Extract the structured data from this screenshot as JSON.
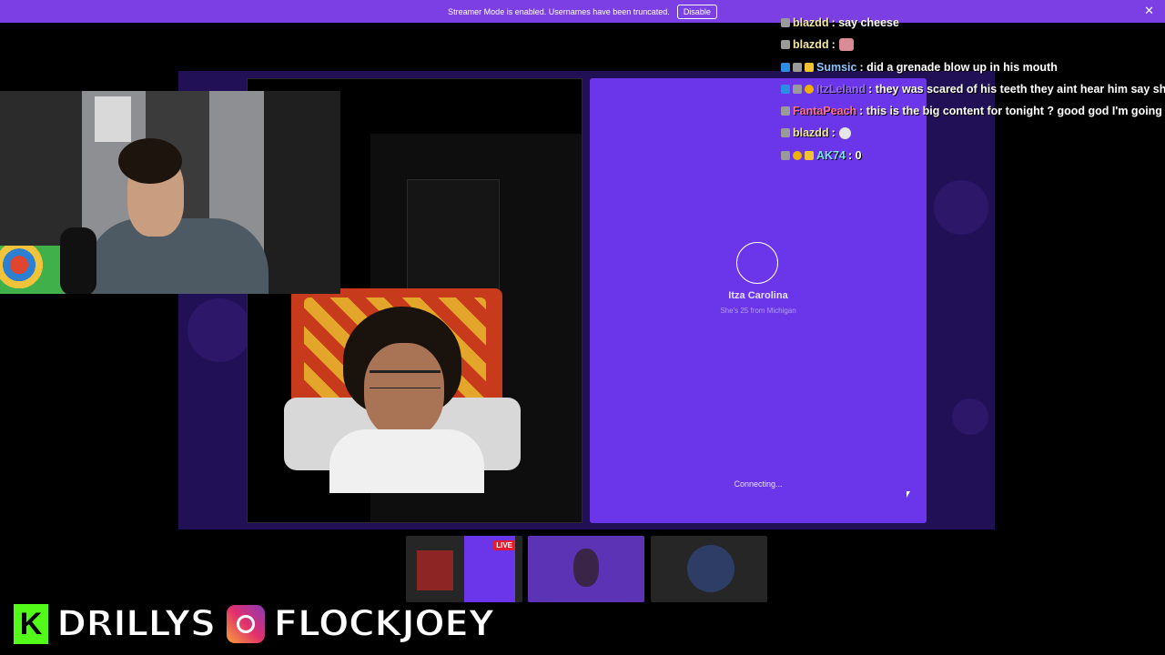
{
  "banner": {
    "text": "Streamer Mode is enabled. Usernames have been truncated.",
    "disable_label": "Disable",
    "close_glyph": "✕"
  },
  "partner": {
    "name": "Itza Carolina",
    "subtitle": "She's 25 from Michigan",
    "status": "Connecting..."
  },
  "chat": [
    {
      "user": "blazdd",
      "text": ": say cheese",
      "color": "#f0e6a8"
    },
    {
      "user": "blazdd",
      "text": ":",
      "color": "#f0e6a8"
    },
    {
      "user": "Sumsic",
      "text": ": did a grenade blow up in his mouth",
      "color": "#8fc4ff"
    },
    {
      "user": "ItzLeland",
      "text": ": they was scared of his teeth they aint hear him say sh",
      "color": "#9b6bff"
    },
    {
      "user": "FantaPeach",
      "text": ": this is the big content for tonight ? good god I'm going t",
      "color": "#ff6f91"
    },
    {
      "user": "blazdd",
      "text": ":",
      "color": "#f0e6a8"
    },
    {
      "user": "AK74",
      "text": ": 0",
      "color": "#7ee3ff"
    }
  ],
  "thumbs": {
    "live_label": "LIVE"
  },
  "socials": {
    "kick_letter": "K",
    "kick_handle": "DRILLYS",
    "ig_handle": "FLOCKJOEY"
  },
  "colors": {
    "accent": "#6b35ea",
    "banner": "#7b3fe4",
    "stage": "#221057"
  }
}
